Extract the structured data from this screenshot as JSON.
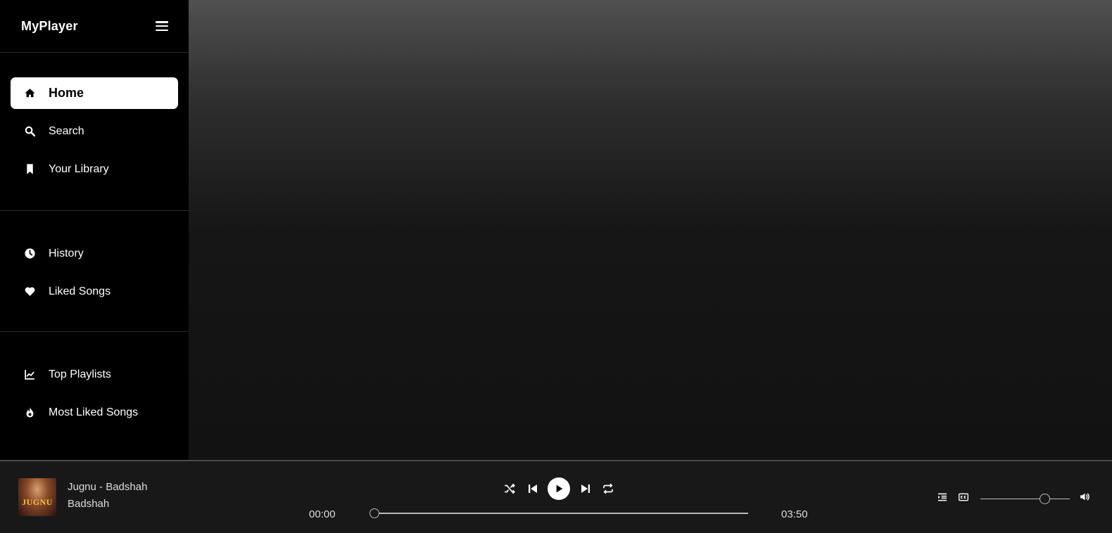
{
  "app": {
    "brand": "MyPlayer"
  },
  "sidebar": {
    "groups": [
      {
        "items": [
          {
            "label": "Home",
            "icon": "home-icon",
            "active": true
          },
          {
            "label": "Search",
            "icon": "search-icon"
          },
          {
            "label": "Your Library",
            "icon": "bookmark-icon"
          }
        ]
      },
      {
        "items": [
          {
            "label": "History",
            "icon": "clock-icon"
          },
          {
            "label": "Liked Songs",
            "icon": "heart-icon"
          }
        ]
      },
      {
        "items": [
          {
            "label": "Top Playlists",
            "icon": "chart-line-icon"
          },
          {
            "label": "Most Liked Songs",
            "icon": "fire-icon"
          }
        ]
      }
    ]
  },
  "player": {
    "cover_text": "JUGNU",
    "track_title": "Jugnu - Badshah",
    "artist": "Badshah",
    "current_time": "00:00",
    "duration": "03:50",
    "progress": 0,
    "volume": 0.72
  },
  "colors": {
    "accent": "#ffffff",
    "sidebar_bg": "#000000",
    "player_bg": "#181818"
  }
}
